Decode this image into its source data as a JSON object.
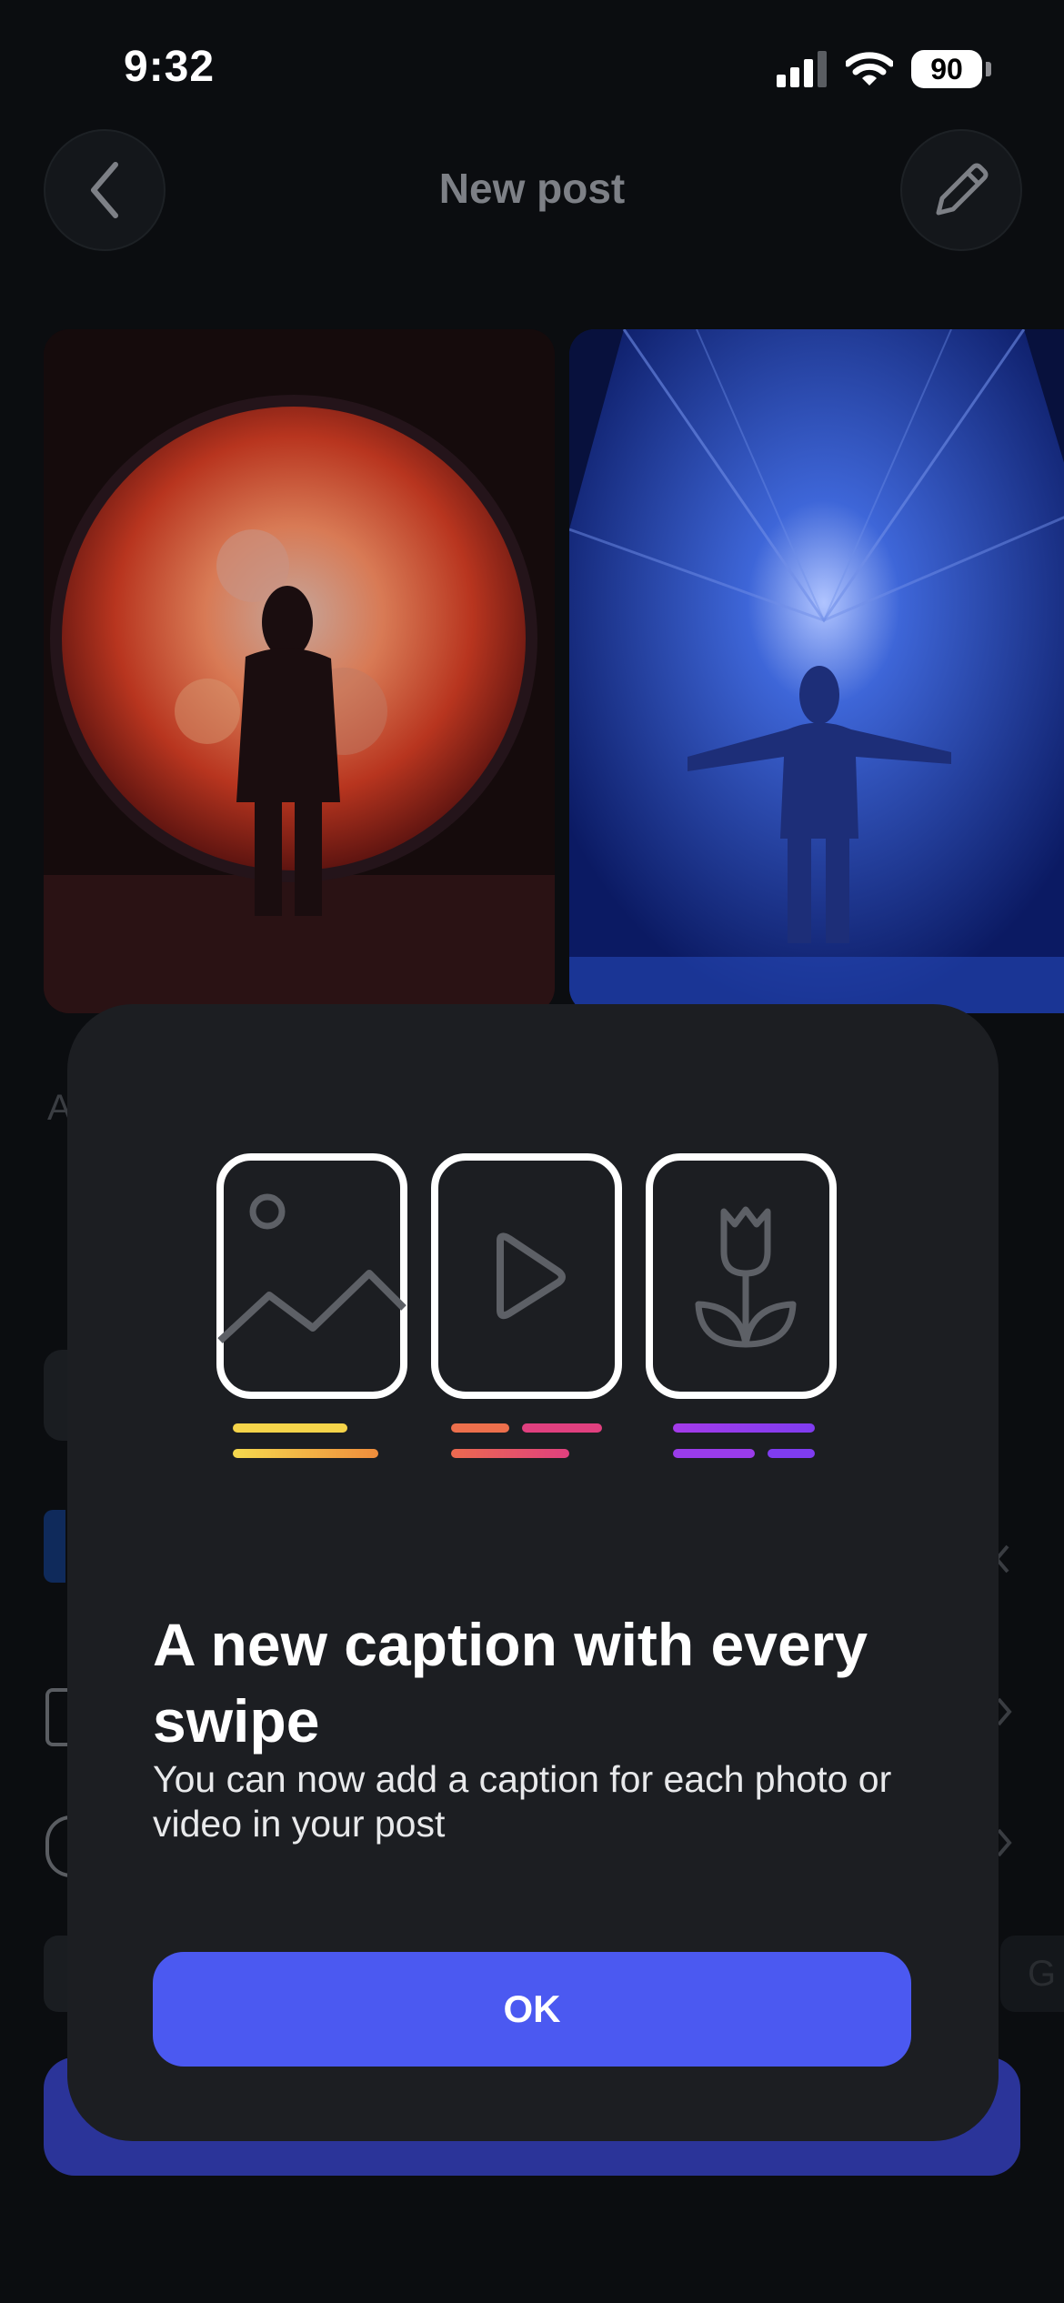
{
  "status_bar": {
    "time": "9:32",
    "battery": "90"
  },
  "header": {
    "title": "New post",
    "back_icon": "chevron-left-icon",
    "edit_icon": "pencil-icon"
  },
  "background": {
    "partial_label": "A",
    "partial_chip_text": "G"
  },
  "modal": {
    "headline": "A new caption with every swipe",
    "subtext": "You can now add a caption for each photo or video in your post",
    "ok_label": "OK",
    "illustration_icons": [
      "image-icon",
      "play-icon",
      "tulip-icon"
    ],
    "accent_colors": {
      "yellow": "#f5cf4a",
      "orange": "#ef8d3c",
      "pink": "#e6407d",
      "purple": "#8f3cf0",
      "button": "#4b59f1"
    }
  }
}
